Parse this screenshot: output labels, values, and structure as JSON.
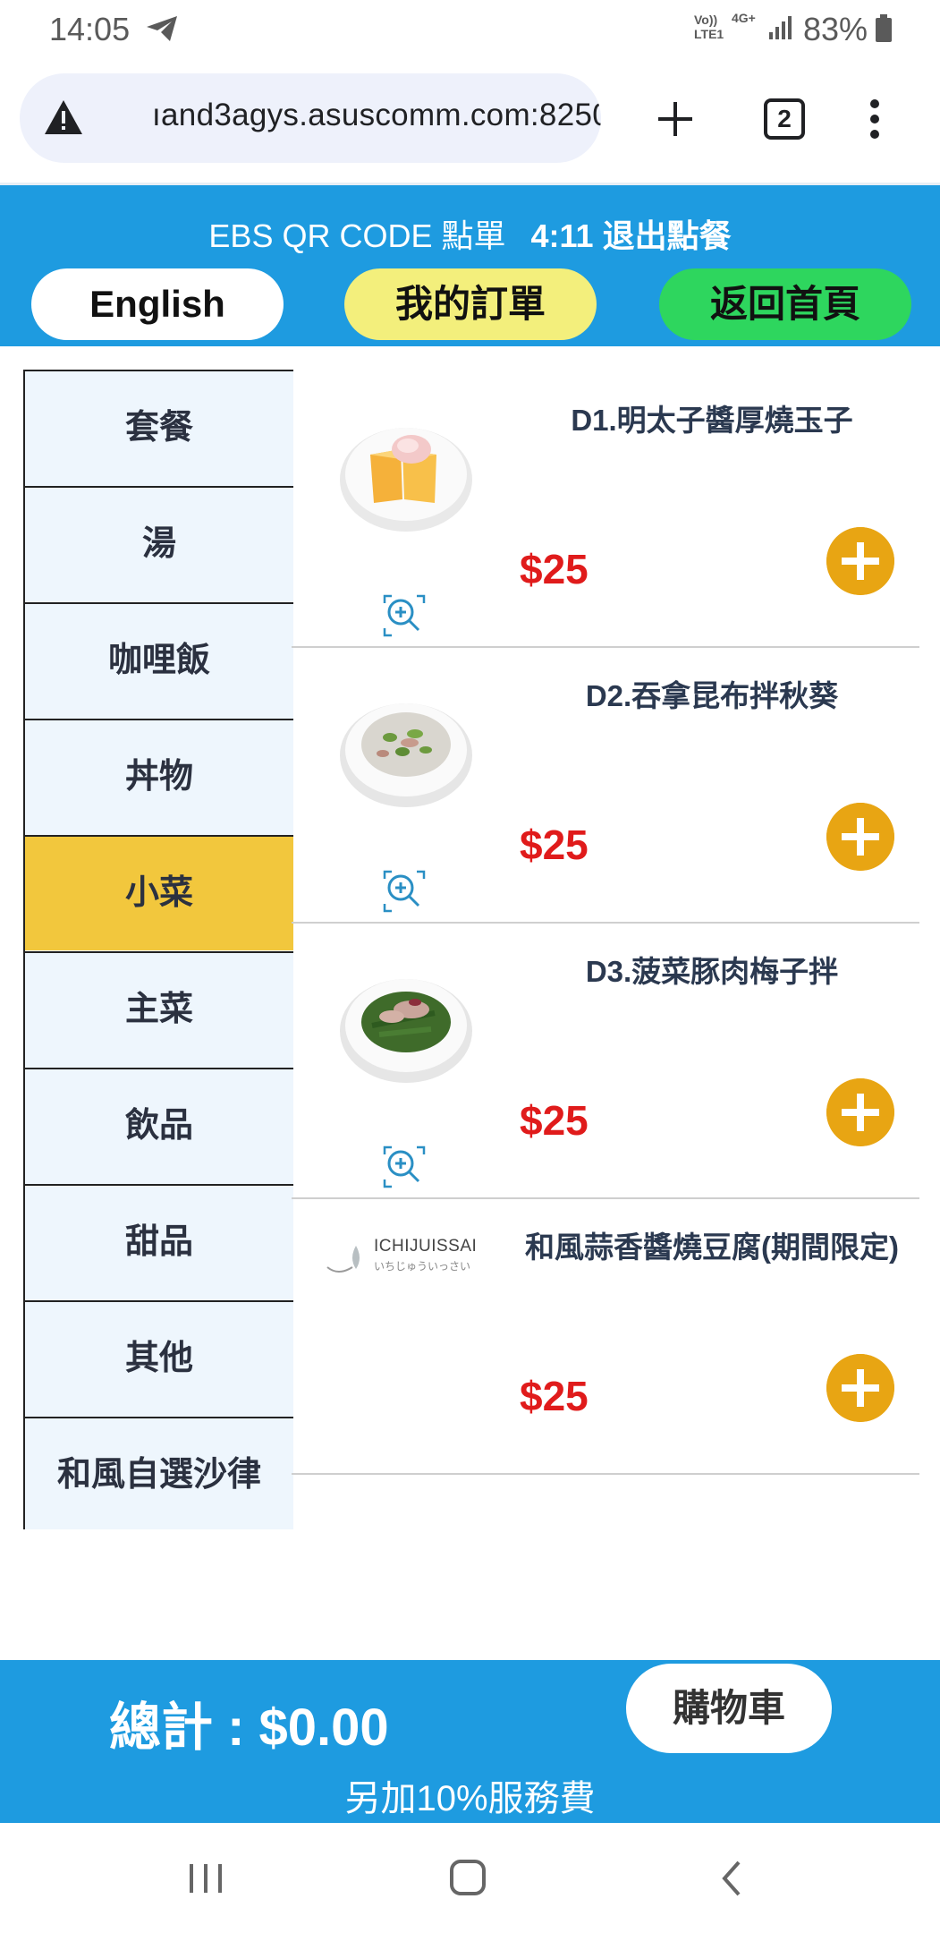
{
  "status_bar": {
    "time": "14:05",
    "network_top": "Vo))",
    "network_bottom": "LTE1",
    "data_type": "4G+",
    "battery": "83%",
    "icons": [
      "telegram-send-icon",
      "signal-icon",
      "battery-icon"
    ]
  },
  "browser": {
    "url": "nand3agys.asuscomm.com:8250",
    "url_visible": "ıand3agys.asuscomm.com:8250",
    "tab_count": "2",
    "icons": [
      "warning-icon",
      "new-tab-icon",
      "tabs-icon",
      "more-icon"
    ]
  },
  "header": {
    "title": "EBS QR CODE 點單",
    "timer_exit": "4:11 退出點餐",
    "english_label": "English",
    "my_orders_label": "我的訂單",
    "home_label": "返回首頁"
  },
  "sidebar": {
    "items": [
      {
        "label": "套餐"
      },
      {
        "label": "湯"
      },
      {
        "label": "咖哩飯"
      },
      {
        "label": "丼物"
      },
      {
        "label": "小菜",
        "active": true
      },
      {
        "label": "主菜"
      },
      {
        "label": "飲品"
      },
      {
        "label": "甜品"
      },
      {
        "label": "其他"
      },
      {
        "label": "和風自選沙律"
      }
    ]
  },
  "menu_items": [
    {
      "name": "D1.明太子醬厚燒玉子",
      "price": "$25",
      "image": "tamagoyaki-photo"
    },
    {
      "name": "D2.吞拿昆布拌秋葵",
      "price": "$25",
      "image": "okra-tuna-photo"
    },
    {
      "name": "D3.菠菜豚肉梅子拌",
      "price": "$25",
      "image": "spinach-pork-photo"
    },
    {
      "name": "和風蒜香醬燒豆腐(期間限定)",
      "price": "$25",
      "image": "brand-logo",
      "brand_name": "ICHIJUISSAI",
      "brand_sub": "いちじゅういっさい"
    }
  ],
  "footer": {
    "total": "總計 : $0.00",
    "cart_label": "購物車",
    "service_note": "另加10%服務費"
  },
  "colors": {
    "header_blue": "#1e9be0",
    "active_category": "#f2c73d",
    "price_red": "#e01b1b",
    "add_button": "#e8a513",
    "orders_yellow": "#f3ef7c",
    "home_green": "#2ed65e"
  }
}
